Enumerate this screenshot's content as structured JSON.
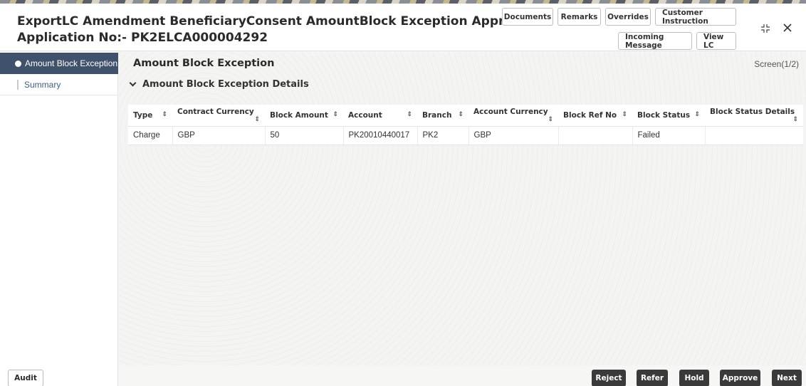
{
  "header": {
    "title_line1": "ExportLC Amendment BeneficiaryConsent AmountBlock Exception Approval ::",
    "title_line2": "Application No:- PK2ELCA000004292",
    "buttons": {
      "documents": "Documents",
      "remarks": "Remarks",
      "overrides": "Overrides",
      "customer_instruction": "Customer Instruction",
      "incoming_message": "Incoming Message",
      "view_lc": "View LC"
    },
    "icons": {
      "maximize": "maximize-icon",
      "close": "close-icon"
    }
  },
  "sidebar": {
    "items": [
      {
        "label": "Amount Block Exception",
        "active": true
      },
      {
        "label": "Summary",
        "active": false
      }
    ]
  },
  "main": {
    "section_title": "Amount Block Exception",
    "screen_count": "Screen(1/2)",
    "sub_section": "Amount Block Exception Details",
    "table": {
      "columns": [
        "Type",
        "Contract Currency",
        "Block Amount",
        "Account",
        "Branch",
        "Account Currency",
        "Block Ref No",
        "Block Status",
        "Block Status Details"
      ],
      "rows": [
        [
          "Charge",
          "GBP",
          "50",
          "PK20010440017",
          "PK2",
          "GBP",
          "",
          "Failed",
          ""
        ]
      ]
    }
  },
  "footer": {
    "audit": "Audit",
    "reject": "Reject",
    "refer": "Refer",
    "hold": "Hold",
    "approve": "Approve",
    "next": "Next"
  },
  "colors": {
    "sidebar_active": "#40526b",
    "link": "#3c5f8a",
    "footer_button": "#3a3a3a"
  }
}
